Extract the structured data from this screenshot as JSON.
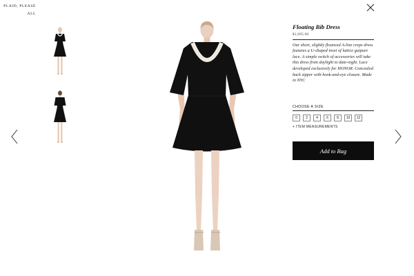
{
  "nav": {
    "items": [
      "PLAID, PLEASE",
      "ALL"
    ]
  },
  "product": {
    "title": "Floating Bib Dress",
    "price": "$1,695.00",
    "description": "Our short, slightly flounced A-line crepe dress features a U-shaped inset of lattice guipure lace. A simple switch of accessories will take this dress from daylight to date-night. Lace developed exclusively for HONOR. Concealed back zipper with hook-and-eye closure. Made in NYC"
  },
  "size_picker": {
    "label": "CHOOSE A SIZE",
    "sizes": [
      "0",
      "2",
      "4",
      "6",
      "8",
      "10",
      "12"
    ]
  },
  "measurements_link": "+ ITEM MEASUREMENTS",
  "add_to_bag_label": "Add to Bag",
  "icons": {
    "close": "close-icon",
    "prev": "chevron-left-icon",
    "next": "chevron-right-icon"
  },
  "colors": {
    "button_bg": "#0d0d0d",
    "dress": "#111111",
    "lace_trim": "#f1ede4",
    "skin": "#e9c9b3"
  }
}
